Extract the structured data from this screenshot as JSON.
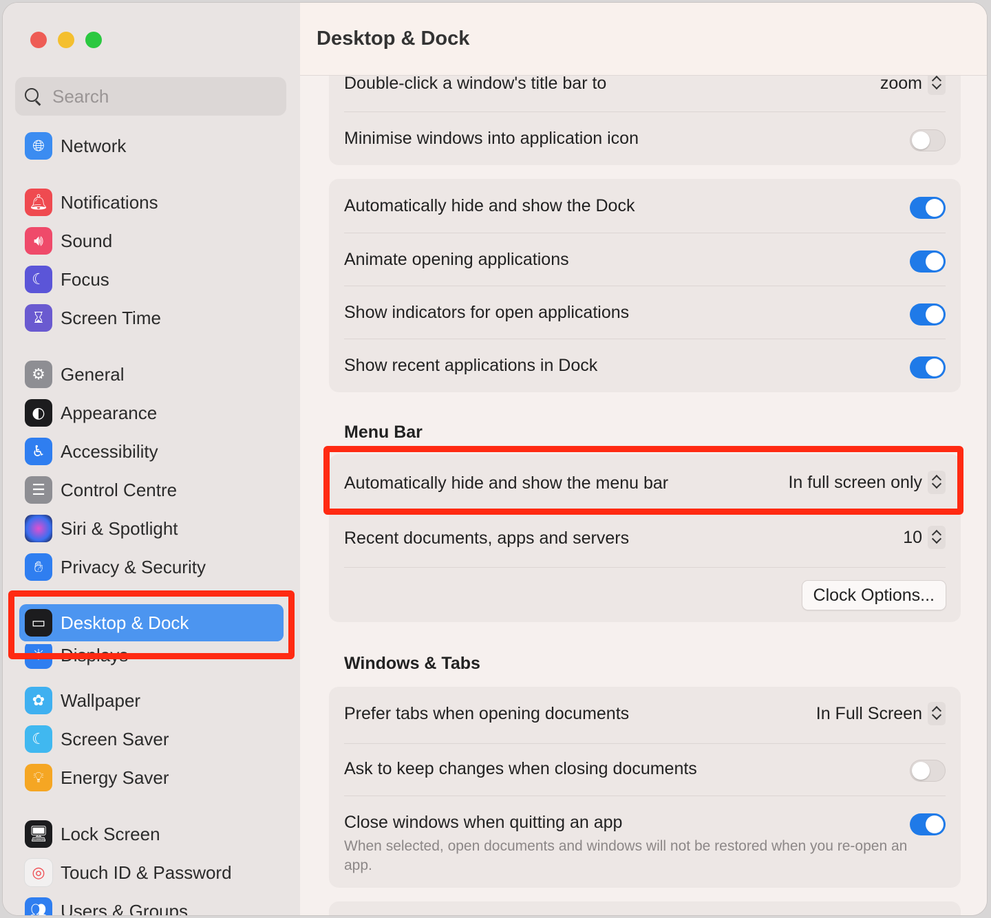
{
  "window": {
    "title": "Desktop & Dock",
    "traffic_lights": {
      "close": "#ee5c55",
      "minimize": "#f4bf2f",
      "zoom": "#2bc840"
    }
  },
  "search": {
    "placeholder": "Search"
  },
  "sidebar": {
    "items": [
      {
        "label": "Network",
        "icon": "globe-icon",
        "color": "#3b8cf1"
      },
      {
        "label": "Notifications",
        "icon": "bell-icon",
        "color": "#ef4a50"
      },
      {
        "label": "Sound",
        "icon": "speaker-icon",
        "color": "#ef4a6a"
      },
      {
        "label": "Focus",
        "icon": "moon-icon",
        "color": "#5b55d8"
      },
      {
        "label": "Screen Time",
        "icon": "hourglass-icon",
        "color": "#6a5ad0"
      },
      {
        "label": "General",
        "icon": "gear-icon",
        "color": "#8e8e93"
      },
      {
        "label": "Appearance",
        "icon": "appearance-icon",
        "color": "#1c1c1e"
      },
      {
        "label": "Accessibility",
        "icon": "accessibility-icon",
        "color": "#2f7ef0"
      },
      {
        "label": "Control Centre",
        "icon": "control-centre-icon",
        "color": "#8e8e93"
      },
      {
        "label": "Siri & Spotlight",
        "icon": "siri-icon",
        "color": "#2a2a6a"
      },
      {
        "label": "Privacy & Security",
        "icon": "hand-icon",
        "color": "#2f7ef0"
      },
      {
        "label": "Desktop & Dock",
        "icon": "dock-icon",
        "color": "#1c1c1e",
        "active": true
      },
      {
        "label": "Displays",
        "icon": "sun-icon",
        "color": "#2f7ef0"
      },
      {
        "label": "Wallpaper",
        "icon": "flower-icon",
        "color": "#3fb0f0"
      },
      {
        "label": "Screen Saver",
        "icon": "screensaver-icon",
        "color": "#40b8f0"
      },
      {
        "label": "Energy Saver",
        "icon": "bulb-icon",
        "color": "#f5a623"
      },
      {
        "label": "Lock Screen",
        "icon": "lock-screen-icon",
        "color": "#1c1c1e"
      },
      {
        "label": "Touch ID & Password",
        "icon": "fingerprint-icon",
        "color": "#f2f0f0"
      },
      {
        "label": "Users & Groups",
        "icon": "users-icon",
        "color": "#2f7ef0"
      }
    ]
  },
  "dock_windows": {
    "double_click_label": "Double-click a window's title bar to",
    "double_click_value": "zoom",
    "minimise_label": "Minimise windows into application icon",
    "minimise_on": false
  },
  "dock_behavior": {
    "rows": [
      {
        "label": "Automatically hide and show the Dock",
        "on": true
      },
      {
        "label": "Animate opening applications",
        "on": true
      },
      {
        "label": "Show indicators for open applications",
        "on": true
      },
      {
        "label": "Show recent applications in Dock",
        "on": true
      }
    ]
  },
  "menu_bar": {
    "section_title": "Menu Bar",
    "autohide_label": "Automatically hide and show the menu bar",
    "autohide_value": "In full screen only",
    "recent_label": "Recent documents, apps and servers",
    "recent_value": "10",
    "clock_button": "Clock Options..."
  },
  "windows_tabs": {
    "section_title": "Windows & Tabs",
    "prefer_tabs_label": "Prefer tabs when opening documents",
    "prefer_tabs_value": "In Full Screen",
    "ask_keep_label": "Ask to keep changes when closing documents",
    "ask_keep_on": false,
    "close_windows_label": "Close windows when quitting an app",
    "close_windows_on": true,
    "close_windows_desc": "When selected, open documents and windows will not be restored when you re-open an app."
  },
  "highlight_color": "#ff2a12"
}
